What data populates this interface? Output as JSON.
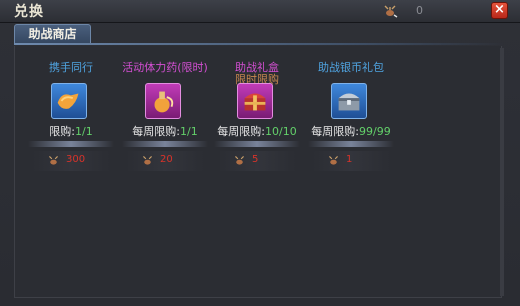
{
  "window": {
    "title": "兑换",
    "currency_amount": "0",
    "close_label": "×"
  },
  "tabs": [
    {
      "label": "助战商店"
    }
  ],
  "items": [
    {
      "name": "携手同行",
      "subtitle": "",
      "name_color": "#4fa3e0",
      "limit_label": "限购:",
      "limit_value": "1/1",
      "price": "300",
      "icon": "wings-icon",
      "icon_bg": "#2f73c4"
    },
    {
      "name": "活动体力药(限时)",
      "subtitle": "",
      "name_color": "#d34fd2",
      "limit_label": "每周限购:",
      "limit_value": "1/1",
      "price": "20",
      "icon": "potion-icon",
      "icon_bg": "#b02fa6"
    },
    {
      "name": "助战礼盒",
      "subtitle": "限时限购",
      "name_color": "#d34fd2",
      "subtitle_color": "#c9884f",
      "limit_label": "每周限购:",
      "limit_value": "10/10",
      "price": "5",
      "icon": "gift-chest-icon",
      "icon_bg": "#b02fa6"
    },
    {
      "name": "助战银币礼包",
      "subtitle": "",
      "name_color": "#4fa3e0",
      "limit_label": "每周限购:",
      "limit_value": "99/99",
      "price": "1",
      "icon": "silver-chest-icon",
      "icon_bg": "#2f73c4"
    }
  ]
}
